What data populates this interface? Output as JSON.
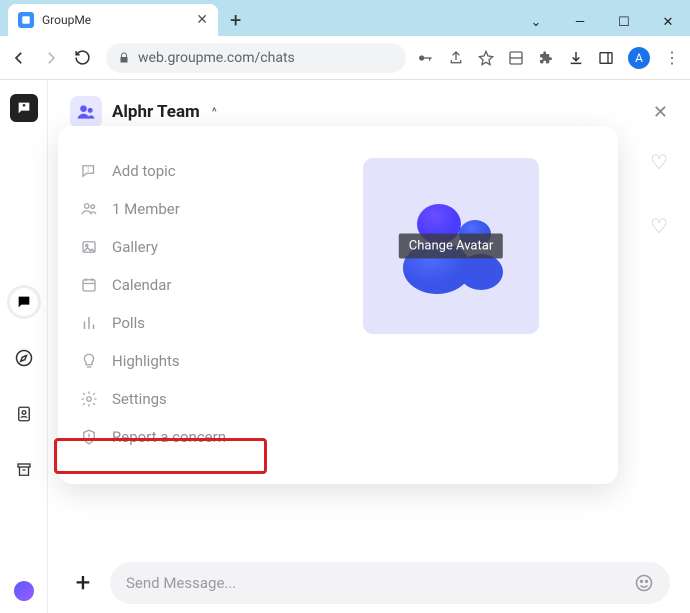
{
  "browser": {
    "tab_title": "GroupMe",
    "url": "web.groupme.com/chats",
    "profile_letter": "A"
  },
  "chat": {
    "title": "Alphr Team",
    "caret": "^"
  },
  "menu": {
    "items": [
      {
        "label": "Add topic"
      },
      {
        "label": "1 Member"
      },
      {
        "label": "Gallery"
      },
      {
        "label": "Calendar"
      },
      {
        "label": "Polls"
      },
      {
        "label": "Highlights"
      },
      {
        "label": "Settings"
      },
      {
        "label": "Report a concern"
      }
    ]
  },
  "avatar_overlay": "Change Avatar",
  "composer": {
    "placeholder": "Send Message..."
  }
}
